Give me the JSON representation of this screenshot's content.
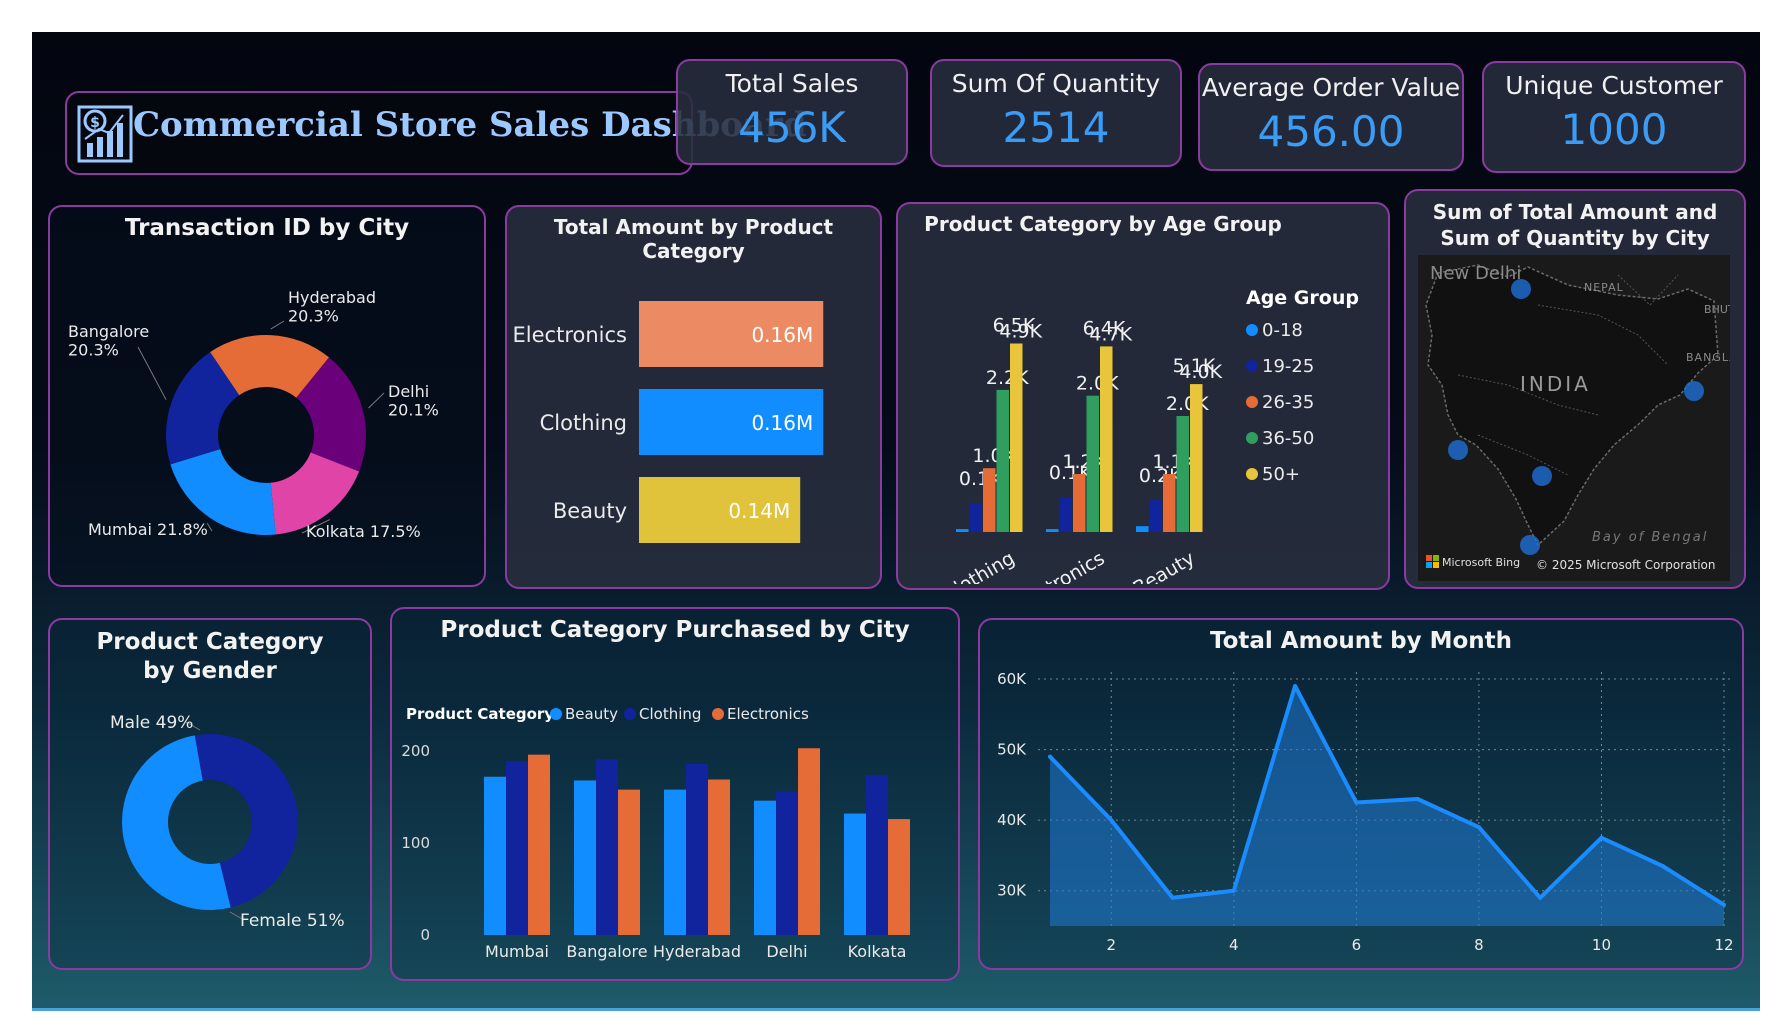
{
  "header": {
    "title": "Commercial Store Sales Dashboard",
    "kpis": [
      {
        "label": "Total Sales",
        "value": "456K"
      },
      {
        "label": "Sum Of Quantity",
        "value": "2514"
      },
      {
        "label": "Average Order Value",
        "value": "456.00"
      },
      {
        "label": "Unique Customer",
        "value": "1000"
      }
    ]
  },
  "colors": {
    "accent": "#3a9cf5",
    "border": "#8a3aa0",
    "blue": "#118dff",
    "navy": "#12239e",
    "orange": "#e66c37",
    "purple": "#6b007b",
    "pink": "#e044a7",
    "green": "#1aab40",
    "yellow": "#d9b300"
  },
  "chart_data": [
    {
      "id": "city_donut",
      "type": "pie",
      "title": "Transaction ID by City",
      "labels": [
        "Hyderabad",
        "Delhi",
        "Kolkata",
        "Mumbai",
        "Bangalore"
      ],
      "values": [
        20.3,
        20.1,
        17.5,
        21.8,
        20.3
      ],
      "label_texts": [
        "Hyderabad\n20.3%",
        "Delhi\n20.1%",
        "Kolkata 17.5%",
        "Mumbai 21.8%",
        "Bangalore\n20.3%"
      ],
      "colors": [
        "#e66c37",
        "#6b007b",
        "#e044a7",
        "#118dff",
        "#12239e"
      ]
    },
    {
      "id": "amount_by_category",
      "type": "bar",
      "title": "Total Amount by Product Category",
      "categories": [
        "Electronics",
        "Clothing",
        "Beauty"
      ],
      "values": [
        0.16,
        0.16,
        0.14
      ],
      "value_labels": [
        "0.16M",
        "0.16M",
        "0.14M"
      ],
      "colors": [
        "#ec8b63",
        "#118dff",
        "#e0c33a"
      ]
    },
    {
      "id": "category_by_age",
      "type": "bar",
      "title": "Product Category by Age Group",
      "legend_title": "Age Group",
      "categories": [
        "Clothing",
        "Electronics",
        "Beauty"
      ],
      "series": [
        {
          "name": "0-18",
          "values": [
            0.1,
            0.1,
            0.2
          ],
          "labels": [
            "",
            "",
            ""
          ]
        },
        {
          "name": "19-25",
          "values": [
            1.0,
            1.2,
            1.1
          ],
          "labels": [
            "0.1K",
            "0.1K",
            "0.2K"
          ]
        },
        {
          "name": "26-35",
          "values": [
            2.2,
            2.0,
            2.0
          ],
          "labels": [
            "1.0K",
            "1.2K",
            "1.1K"
          ]
        },
        {
          "name": "36-50",
          "values": [
            4.9,
            4.7,
            4.0
          ],
          "labels": [
            "2.2K",
            "2.0K",
            "2.0K"
          ]
        },
        {
          "name": "50+",
          "values": [
            6.5,
            6.4,
            5.1
          ],
          "labels": [
            "4.9K",
            "4.7K",
            "4.0K"
          ]
        }
      ],
      "top_labels": [
        "6.5K",
        "6.4K",
        "5.1K"
      ],
      "colors": [
        "#118dff",
        "#12239e",
        "#e66c37",
        "#2f9e5f",
        "#e8c53a"
      ],
      "legend_position": "right"
    },
    {
      "id": "gender_donut",
      "type": "pie",
      "title": "Product Category by Gender",
      "labels": [
        "Male",
        "Female"
      ],
      "values": [
        49,
        51
      ],
      "label_texts": [
        "Male 49%",
        "Female 51%"
      ],
      "colors": [
        "#12239e",
        "#118dff"
      ]
    },
    {
      "id": "category_by_city",
      "type": "bar",
      "title": "Product Category Purchased by City",
      "legend_title": "Product Category",
      "categories": [
        "Mumbai",
        "Bangalore",
        "Hyderabad",
        "Delhi",
        "Kolkata"
      ],
      "series": [
        {
          "name": "Beauty",
          "values": [
            172,
            168,
            158,
            146,
            132
          ]
        },
        {
          "name": "Clothing",
          "values": [
            189,
            191,
            186,
            156,
            174
          ]
        },
        {
          "name": "Electronics",
          "values": [
            196,
            158,
            169,
            203,
            126
          ]
        }
      ],
      "yticks": [
        0,
        100,
        200
      ],
      "ylim": [
        0,
        220
      ],
      "colors": [
        "#118dff",
        "#12239e",
        "#e66c37"
      ],
      "legend_position": "top-left"
    },
    {
      "id": "amount_by_month",
      "type": "area",
      "title": "Total Amount by Month",
      "x": [
        1,
        2,
        3,
        4,
        5,
        6,
        7,
        8,
        9,
        10,
        11,
        12
      ],
      "values": [
        49000,
        40000,
        29000,
        30000,
        59000,
        42500,
        43000,
        39000,
        29000,
        37500,
        33500,
        28000
      ],
      "xticks": [
        2,
        4,
        6,
        8,
        10,
        12
      ],
      "yticks": [
        "30K",
        "40K",
        "50K",
        "60K"
      ],
      "ylim": [
        25000,
        61000
      ],
      "grid": true
    }
  ],
  "map": {
    "title": "Sum of Total Amount and Sum of Quantity by City",
    "labels": [
      "New Delhi",
      "NEPAL",
      "BHUT",
      "INDIA",
      "BANGLA",
      "Bay of Bengal"
    ],
    "credit_left": "Microsoft Bing",
    "credit_right": "© 2025 Microsoft Corporation"
  }
}
